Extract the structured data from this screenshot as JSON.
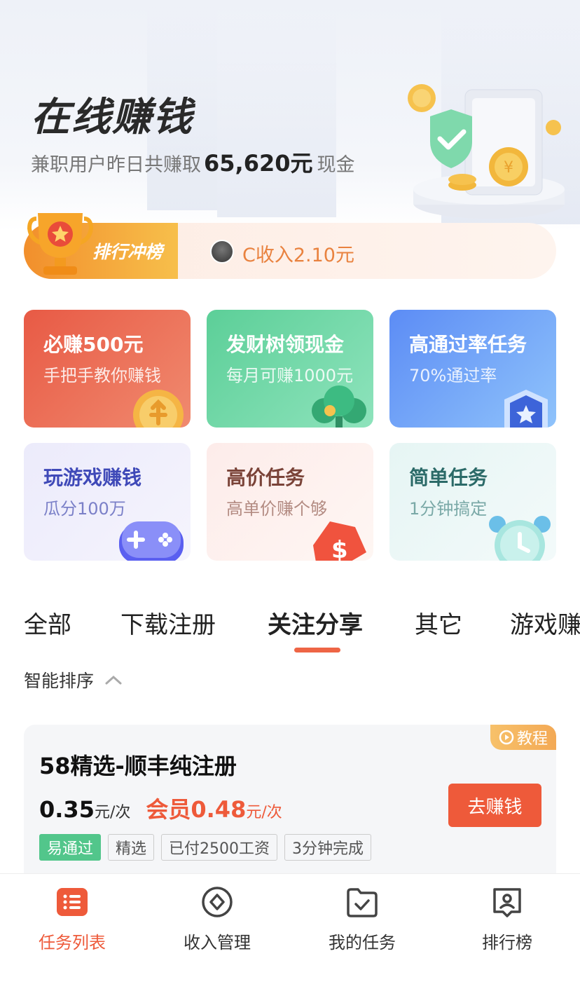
{
  "hero": {
    "title": "在线赚钱",
    "sub_prefix": "兼职用户昨日共赚取",
    "amount": "65,620元",
    "sub_suffix": "现金"
  },
  "rank": {
    "label": "排行冲榜",
    "ticker": "C收入2.10元"
  },
  "cards": [
    {
      "title": "必赚500元",
      "subtitle": "手把手教你赚钱",
      "icon": "coin-icon"
    },
    {
      "title": "发财树领现金",
      "subtitle": "每月可赚1000元",
      "icon": "money-tree-icon"
    },
    {
      "title": "高通过率任务",
      "subtitle": "70%通过率",
      "icon": "star-badge-icon"
    },
    {
      "title": "玩游戏赚钱",
      "subtitle": "瓜分100万",
      "icon": "gamepad-icon"
    },
    {
      "title": "高价任务",
      "subtitle": "高单价赚个够",
      "icon": "price-tag-icon"
    },
    {
      "title": "简单任务",
      "subtitle": "1分钟搞定",
      "icon": "alarm-clock-icon"
    }
  ],
  "tabs": [
    {
      "label": "全部"
    },
    {
      "label": "下载注册"
    },
    {
      "label": "关注分享",
      "active": true
    },
    {
      "label": "其它"
    },
    {
      "label": "游戏赚"
    }
  ],
  "sort": {
    "label": "智能排序"
  },
  "task": {
    "tutorial": "教程",
    "name": "58精选-顺丰纯注册",
    "price": "0.35",
    "unit": "元/次",
    "member_price": "会员0.48",
    "member_unit": "元/次",
    "action": "去赚钱",
    "tags": [
      "易通过",
      "精选",
      "已付2500工资",
      "3分钟完成"
    ]
  },
  "nav": [
    {
      "label": "任务列表",
      "icon": "task-list-icon",
      "active": true
    },
    {
      "label": "收入管理",
      "icon": "income-icon"
    },
    {
      "label": "我的任务",
      "icon": "my-task-icon"
    },
    {
      "label": "排行榜",
      "icon": "leaderboard-icon"
    }
  ],
  "colors": {
    "accent": "#ee5a3a",
    "rank_gradient_start": "#f28f2c",
    "green_tag": "#52c68b"
  }
}
